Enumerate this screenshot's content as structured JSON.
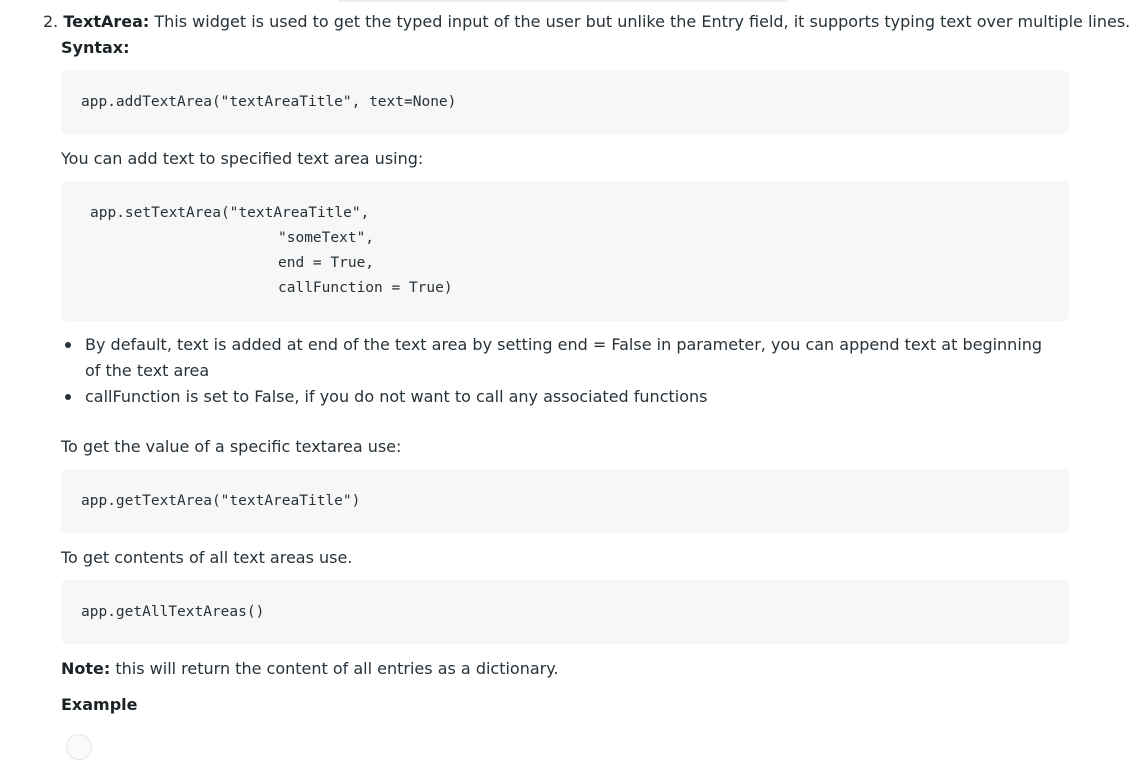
{
  "item": {
    "number": "2.",
    "term": "TextArea:",
    "description": "This widget is used to get the typed input of the user but unlike the Entry field, it supports typing text over multiple lines.",
    "syntax_label": "Syntax:"
  },
  "code1": "app.addTextArea(\"textAreaTitle\", text=None)",
  "para_set": "You can add text to specified text area using:",
  "code2": [
    "app.setTextArea(\"textAreaTitle\",",
    "\"someText\",",
    "end = True,",
    "callFunction = True)"
  ],
  "bullets": [
    "By default, text is added at end of the text area by setting end = False in parameter, you can append text at beginning of the text area",
    "callFunction is set to False, if you do not want to call any associated functions"
  ],
  "para_get": "To get the value of a specific textarea use:",
  "code3": "app.getTextArea(\"textAreaTitle\")",
  "para_all": "To get contents of all text areas use.",
  "code4": "app.getAllTextAreas()",
  "note": {
    "label": "Note:",
    "text": "this will return the content of all entries as a dictionary."
  },
  "example_heading": "Example"
}
